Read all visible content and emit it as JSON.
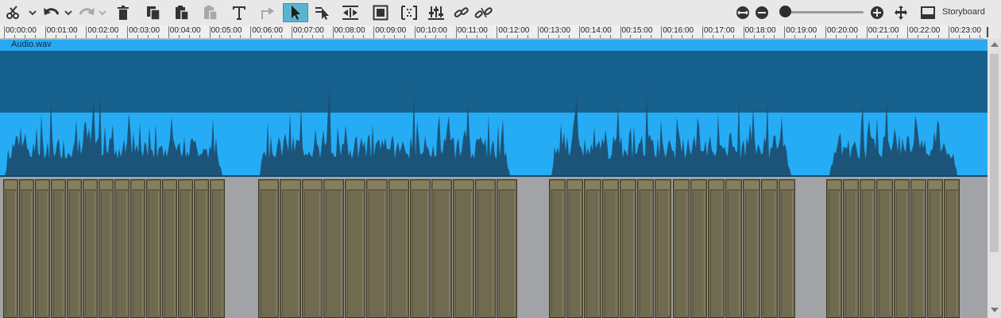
{
  "toolbar": {
    "tools": [
      {
        "name": "scissors-icon",
        "label": "Cut"
      },
      {
        "name": "undo-icon",
        "label": "Undo"
      },
      {
        "name": "redo-icon",
        "label": "Redo"
      },
      {
        "name": "delete-icon",
        "label": "Delete"
      },
      {
        "name": "copy-icon",
        "label": "Copy"
      },
      {
        "name": "paste-icon",
        "label": "Paste"
      },
      {
        "name": "paste-disabled-icon",
        "label": "Paste"
      },
      {
        "name": "text-icon",
        "label": "Title"
      },
      {
        "name": "transition-icon",
        "label": "Transition"
      },
      {
        "name": "pointer-icon",
        "label": "Mouse mode"
      },
      {
        "name": "range-pointer-icon",
        "label": "Range"
      },
      {
        "name": "split-icon",
        "label": "Insert"
      },
      {
        "name": "frame-icon",
        "label": "Frame"
      },
      {
        "name": "marker-icon",
        "label": "Marker"
      },
      {
        "name": "mixer-icon",
        "label": "Mixer"
      },
      {
        "name": "link-icon",
        "label": "Link"
      },
      {
        "name": "unlink-icon",
        "label": "Unlink"
      }
    ],
    "zoom_level": 0.05,
    "storyboard_label": "Storyboard"
  },
  "ruler": {
    "labels": [
      "00:00:00",
      "00:01:00",
      "00:02:00",
      "00:03:00",
      "00:04:00",
      "00:05:00",
      "00:06:00",
      "00:07:00",
      "00:08:00",
      "00:09:00",
      "00:10:00",
      "00:11:00",
      "00:12:00",
      "00:13:00",
      "00:14:00",
      "00:15:00",
      "00:16:00",
      "00:17:00",
      "00:18:00",
      "00:19:00",
      "00:20:00",
      "00:21:00",
      "00:22:00",
      "00:23:00"
    ]
  },
  "audio_clip": {
    "name": "Audio.wav"
  },
  "colors": {
    "accent": "#5bb4cf",
    "audio_head": "#2aa8f2",
    "audio_top": "#17618f",
    "audio_bottom": "#26acf5",
    "waveform": "#1c4a6c",
    "video_clip": "#706a50"
  }
}
